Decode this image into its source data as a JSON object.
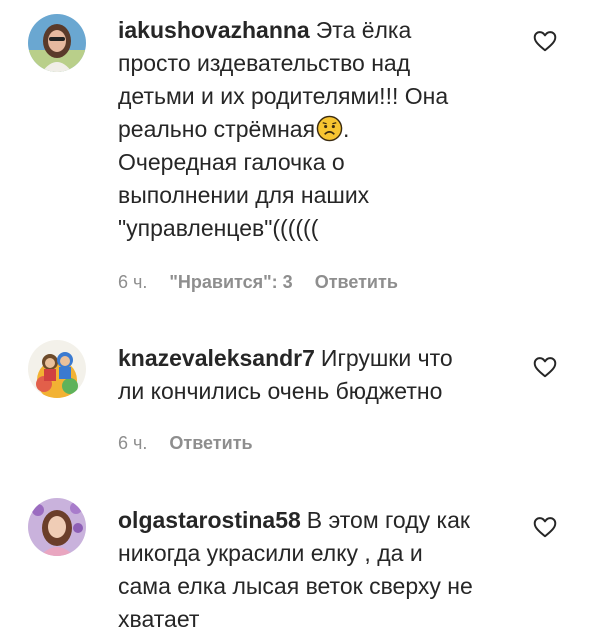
{
  "comments": [
    {
      "username": "iakushovazhanna",
      "text_lines": [
        "Эта ёлка",
        "просто издевательство над",
        "детьми и их родителями!!! Она",
        "реально стрёмная",
        ". ",
        "Очередная галочка о",
        "выполнении для наших",
        "\"управленцев\"(((((("
      ],
      "emoji_icon": "worried-face-emoji",
      "time": "6 ч.",
      "likes": "\"Нравится\": 3",
      "reply_label": "Ответить"
    },
    {
      "username": "knazevaleksandr7",
      "text_lines": [
        "Игрушки что",
        "ли кончились очень бюджетно"
      ],
      "time": "6 ч.",
      "reply_label": "Ответить"
    },
    {
      "username": "olgastarostina58",
      "text_lines": [
        "В этом году как",
        "никогда украсили елку , да и",
        "сама елка лысая веток сверху не",
        "хватает"
      ]
    }
  ],
  "icons": {
    "like": "heart-outline-icon"
  },
  "colors": {
    "text": "#262626",
    "meta": "#8e8e8e",
    "background": "#ffffff"
  }
}
